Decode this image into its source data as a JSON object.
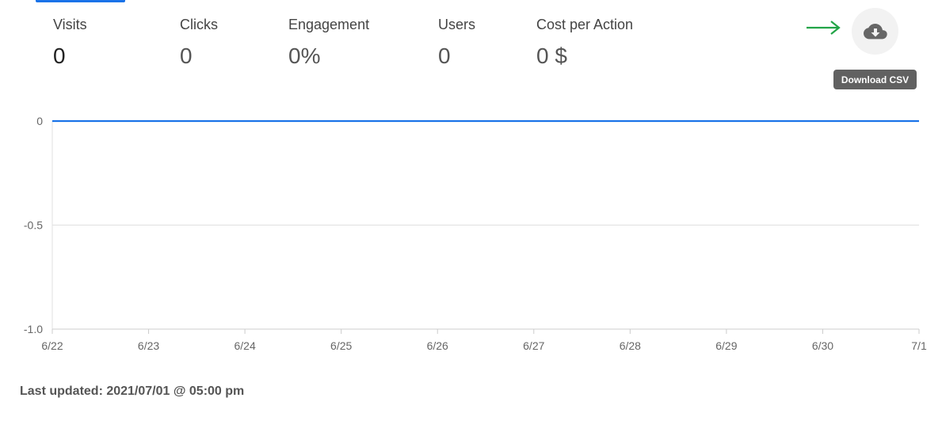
{
  "metrics": [
    {
      "label": "Visits",
      "value": "0"
    },
    {
      "label": "Clicks",
      "value": "0"
    },
    {
      "label": "Engagement",
      "value": "0%"
    },
    {
      "label": "Users",
      "value": "0"
    },
    {
      "label": "Cost per Action",
      "value": "0 $"
    }
  ],
  "download": {
    "icon": "cloud-download-icon",
    "tooltip": "Download CSV"
  },
  "annotation": {
    "icon": "arrow-right-icon",
    "color": "#22a447"
  },
  "chart_data": {
    "type": "line",
    "categories": [
      "6/22",
      "6/23",
      "6/24",
      "6/25",
      "6/26",
      "6/27",
      "6/28",
      "6/29",
      "6/30",
      "7/1"
    ],
    "series": [
      {
        "values": [
          0,
          0,
          0,
          0,
          0,
          0,
          0,
          0,
          0,
          0
        ],
        "color": "#1a73e8"
      }
    ],
    "yticks": [
      "0",
      "-0.5",
      "-1.0"
    ],
    "ylim": [
      -1.0,
      0
    ],
    "grid": true,
    "xlabel": "",
    "ylabel": ""
  },
  "footer": {
    "last_updated": "Last updated: 2021/07/01 @ 05:00 pm"
  }
}
